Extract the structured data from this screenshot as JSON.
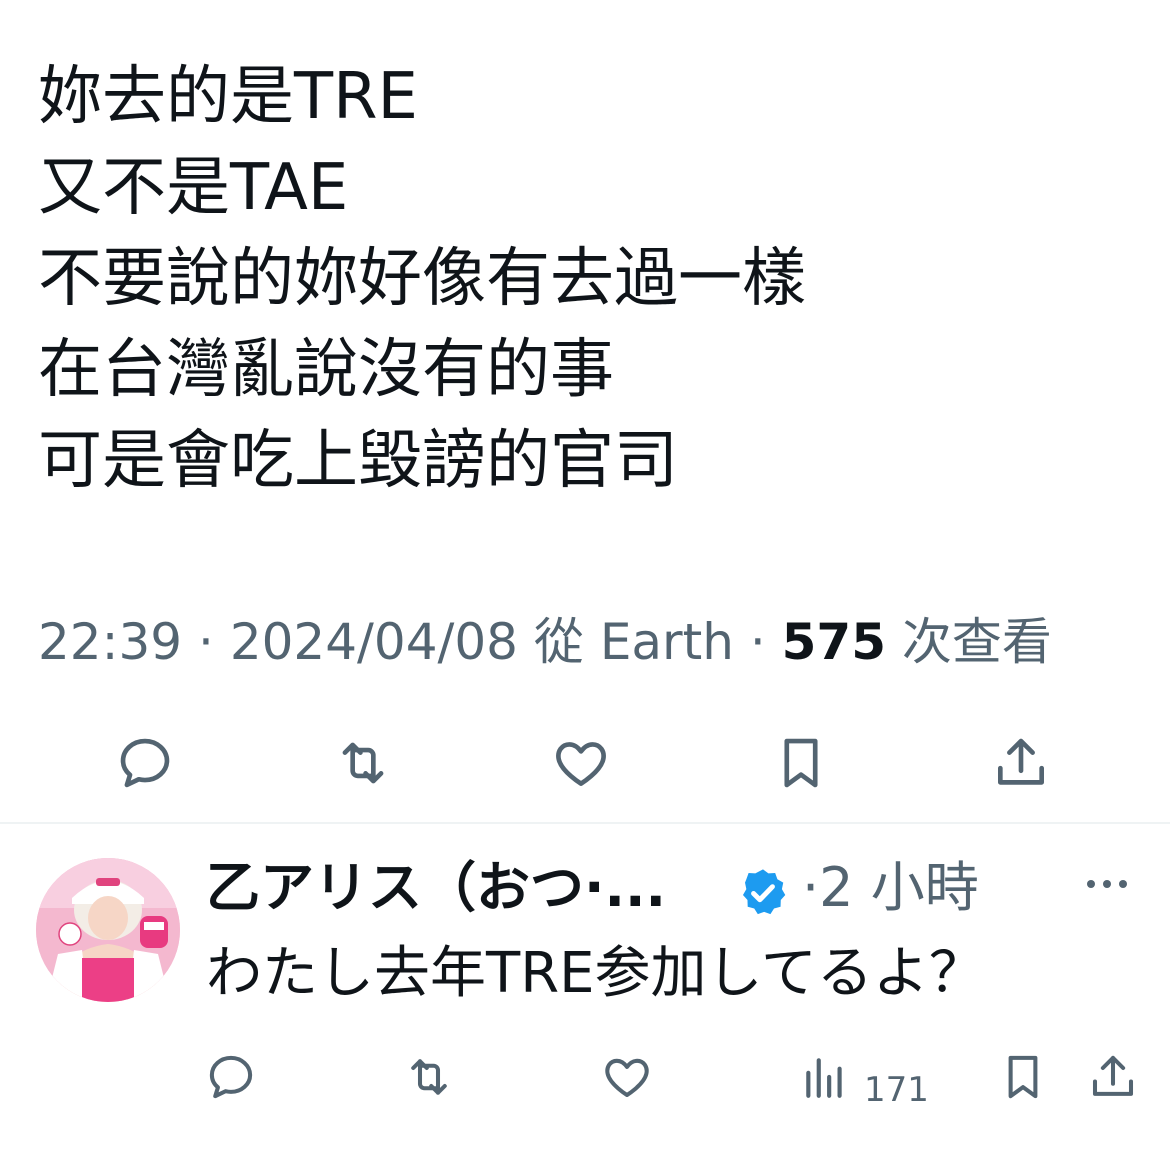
{
  "tweet": {
    "lines": [
      "妳去的是TRE",
      "又不是TAE",
      "不要說的妳好像有去過一樣",
      "在台灣亂說沒有的事",
      "可是會吃上毀謗的官司"
    ],
    "time": "22:39",
    "separator": "·",
    "date": "2024/04/08",
    "source_prefix": "從",
    "source": "Earth",
    "views_count": "575",
    "views_label": "次查看"
  },
  "main_actions": {
    "icons": [
      "reply-icon",
      "retweet-icon",
      "like-icon",
      "bookmark-icon",
      "share-icon"
    ]
  },
  "reply": {
    "author_name": "乙アリス（おつ·...",
    "verified_icon": "verified-badge-icon",
    "separator": "·",
    "time": "2 小時",
    "text": "わたし去年TRE参加してるよ？",
    "views_count": "171",
    "icons": [
      "reply-icon",
      "retweet-icon",
      "like-icon",
      "views-icon",
      "bookmark-icon",
      "share-icon"
    ]
  },
  "colors": {
    "text_primary": "#0f1419",
    "text_secondary": "#536471",
    "verified_blue": "#1d9bf0",
    "divider": "#eff3f4"
  }
}
